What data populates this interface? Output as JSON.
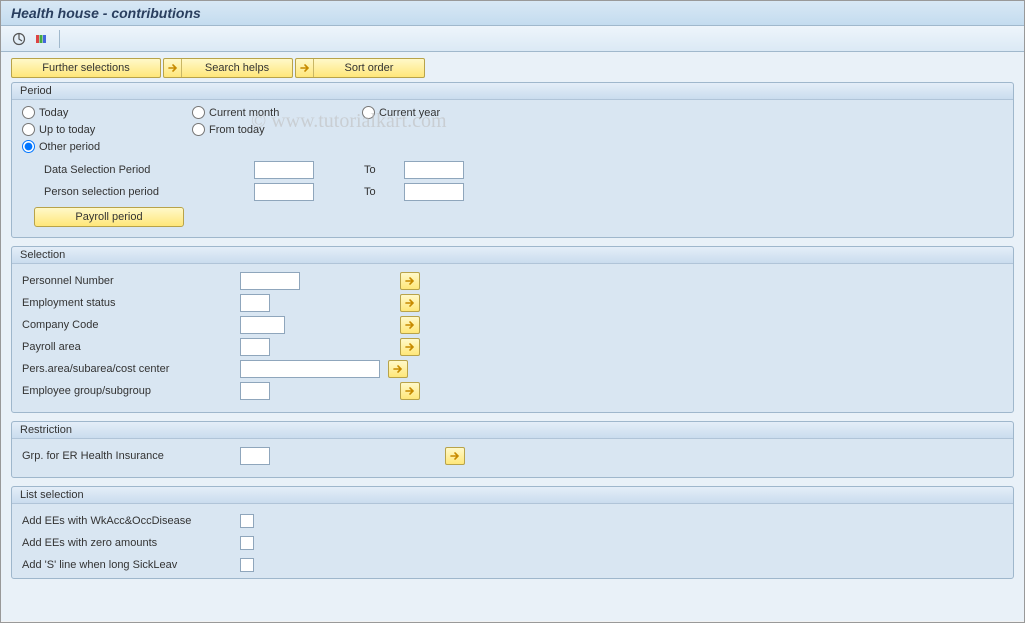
{
  "title": "Health house - contributions",
  "watermark": "© www.tutorialkart.com",
  "buttons": {
    "further": "Further selections",
    "search": "Search helps",
    "sort": "Sort order",
    "payroll": "Payroll period"
  },
  "groups": {
    "period": {
      "title": "Period",
      "radios": {
        "today": "Today",
        "current_month": "Current month",
        "current_year": "Current year",
        "up_to_today": "Up to today",
        "from_today": "From today",
        "other_period": "Other period"
      },
      "data_sel": "Data Selection Period",
      "person_sel": "Person selection period",
      "to": "To"
    },
    "selection": {
      "title": "Selection",
      "personnel": "Personnel Number",
      "emp_status": "Employment status",
      "company": "Company Code",
      "payroll_area": "Payroll area",
      "pers_area": "Pers.area/subarea/cost center",
      "emp_group": "Employee group/subgroup"
    },
    "restriction": {
      "title": "Restriction",
      "grp_er": "Grp. for ER Health Insurance"
    },
    "list": {
      "title": "List selection",
      "add_ees_wk": "Add EEs with WkAcc&OccDisease",
      "add_ees_zero": "Add EEs with zero amounts",
      "add_s_line": "Add 'S' line when long SickLeav"
    }
  }
}
